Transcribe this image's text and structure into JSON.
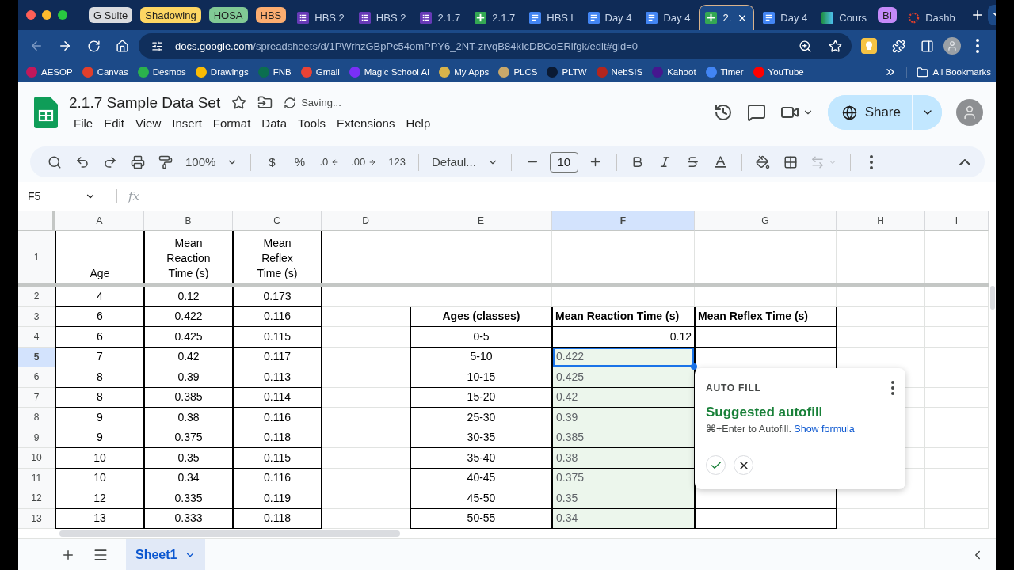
{
  "browser": {
    "tabs": [
      {
        "kind": "group",
        "label": "G Suite",
        "color": "#dadce0",
        "selected": false
      },
      {
        "kind": "group",
        "label": "Shadowing",
        "color": "#fdd663",
        "selected": false
      },
      {
        "kind": "group",
        "label": "HOSA",
        "color": "#81c995",
        "selected": false
      },
      {
        "kind": "group",
        "label": "HBS",
        "color": "#fcad70",
        "selected": false
      },
      {
        "kind": "forms",
        "label": "HBS 2",
        "selected": false
      },
      {
        "kind": "forms",
        "label": "HBS 2",
        "selected": false
      },
      {
        "kind": "forms",
        "label": "2.1.7",
        "selected": false
      },
      {
        "kind": "sheets",
        "label": "2.1.7",
        "selected": false
      },
      {
        "kind": "docs",
        "label": "HBS l",
        "selected": false
      },
      {
        "kind": "docs",
        "label": "Day 4",
        "selected": false
      },
      {
        "kind": "docs",
        "label": "Day 4",
        "selected": false
      },
      {
        "kind": "sheets",
        "label": "2.",
        "selected": true
      },
      {
        "kind": "docs",
        "label": "Day 4",
        "selected": false
      },
      {
        "kind": "classroom",
        "label": "Cours",
        "selected": false
      },
      {
        "kind": "group",
        "label": "BI",
        "color": "#c58af9",
        "selected": false
      },
      {
        "kind": "canvas",
        "label": "Dashb",
        "selected": false
      }
    ],
    "url": {
      "host": "docs.google.com",
      "path": "/spreadsheets/d/1PWrhzGBpPc54omPPY6_2NT-zrvqB84kIcDBCoERifgk/edit#gid=0"
    },
    "bookmarks": [
      {
        "label": "AESOP",
        "color": "#c2185b"
      },
      {
        "label": "Canvas",
        "color": "#e13f2b"
      },
      {
        "label": "Desmos",
        "color": "#2bb24c"
      },
      {
        "label": "Drawings",
        "color": "#fbbc04"
      },
      {
        "label": "FNB",
        "color": "#0b6e4f"
      },
      {
        "label": "Gmail",
        "color": "#ea4335"
      },
      {
        "label": "Magic School AI",
        "color": "#7b2ff7"
      },
      {
        "label": "My Apps",
        "color": "#d9b44a"
      },
      {
        "label": "PLCS",
        "color": "#c9a86a"
      },
      {
        "label": "PLTW",
        "color": "#0a1a33"
      },
      {
        "label": "NebSIS",
        "color": "#b3261e"
      },
      {
        "label": "Kahoot",
        "color": "#46178f"
      },
      {
        "label": "Timer",
        "color": "#4285f4"
      },
      {
        "label": "YouTube",
        "color": "#ff0000"
      }
    ],
    "all_bookmarks": "All Bookmarks"
  },
  "sheets": {
    "title": "2.1.7 Sample Data Set",
    "status": "Saving...",
    "menus": [
      "File",
      "Edit",
      "View",
      "Insert",
      "Format",
      "Data",
      "Tools",
      "Extensions",
      "Help"
    ],
    "share": "Share",
    "toolbar": {
      "zoom": "100%",
      "currency": "$",
      "percent": "%",
      "decimal_decrease": ".0",
      "decimal_increase": ".00",
      "number_format": "123",
      "font": "Defaul...",
      "font_size": "10"
    },
    "name_box": "F5",
    "formula_label": "fx",
    "grid": {
      "columns": [
        {
          "label": "A",
          "selected": false
        },
        {
          "label": "B",
          "selected": false
        },
        {
          "label": "C",
          "selected": false
        },
        {
          "label": "D",
          "selected": false
        },
        {
          "label": "E",
          "selected": false
        },
        {
          "label": "F",
          "selected": true
        },
        {
          "label": "G",
          "selected": false
        },
        {
          "label": "H",
          "selected": false
        },
        {
          "label": "I",
          "selected": false
        }
      ],
      "rows": [
        {
          "number": "1",
          "selected": false,
          "cells": [
            {
              "kind": "header",
              "text": "Age",
              "boxed": true
            },
            {
              "kind": "header",
              "text": "Mean Reaction Time (s)",
              "boxed": true
            },
            {
              "kind": "header",
              "text": "Mean Reflex Time (s)",
              "boxed": true
            },
            {
              "kind": "empty",
              "boxed": false
            },
            {
              "kind": "empty",
              "boxed": false
            },
            {
              "kind": "empty",
              "boxed": false
            },
            {
              "kind": "empty",
              "boxed": false
            },
            {
              "kind": "empty",
              "boxed": false
            },
            {
              "kind": "empty",
              "boxed": false
            }
          ]
        },
        {
          "number": "2",
          "selected": false,
          "cells": [
            {
              "kind": "text",
              "text": "4",
              "boxed": true
            },
            {
              "kind": "text",
              "text": "0.12",
              "boxed": true
            },
            {
              "kind": "text",
              "text": "0.173",
              "boxed": true
            },
            {
              "kind": "empty",
              "boxed": false
            },
            {
              "kind": "empty",
              "boxed": false
            },
            {
              "kind": "empty",
              "boxed": false
            },
            {
              "kind": "empty",
              "boxed": false
            },
            {
              "kind": "empty",
              "boxed": false
            },
            {
              "kind": "empty",
              "boxed": false
            }
          ]
        },
        {
          "number": "3",
          "selected": false,
          "cells": [
            {
              "kind": "text",
              "text": "6",
              "boxed": true
            },
            {
              "kind": "text",
              "text": "0.422",
              "boxed": true
            },
            {
              "kind": "text",
              "text": "0.116",
              "boxed": true
            },
            {
              "kind": "empty",
              "boxed": false
            },
            {
              "kind": "heading",
              "text": "Ages (classes)",
              "boxed": true
            },
            {
              "kind": "title",
              "text": "Mean Reaction Time (s)",
              "boxed": true
            },
            {
              "kind": "title",
              "text": "Mean Reflex Time (s)",
              "boxed": true
            },
            {
              "kind": "empty",
              "boxed": false
            },
            {
              "kind": "empty",
              "boxed": false
            }
          ]
        },
        {
          "number": "4",
          "selected": false,
          "cells": [
            {
              "kind": "text",
              "text": "6",
              "boxed": true
            },
            {
              "kind": "text",
              "text": "0.425",
              "boxed": true
            },
            {
              "kind": "text",
              "text": "0.115",
              "boxed": true
            },
            {
              "kind": "empty",
              "boxed": false
            },
            {
              "kind": "text",
              "text": "0-5",
              "boxed": true
            },
            {
              "kind": "number",
              "text": "0.12",
              "boxed": true
            },
            {
              "kind": "empty",
              "boxed": true
            },
            {
              "kind": "empty",
              "boxed": false
            },
            {
              "kind": "empty",
              "boxed": false
            }
          ]
        },
        {
          "number": "5",
          "selected": true,
          "cells": [
            {
              "kind": "text",
              "text": "7",
              "boxed": true
            },
            {
              "kind": "text",
              "text": "0.42",
              "boxed": true
            },
            {
              "kind": "text",
              "text": "0.117",
              "boxed": true
            },
            {
              "kind": "empty",
              "boxed": false
            },
            {
              "kind": "text",
              "text": "5-10",
              "boxed": true
            },
            {
              "kind": "suggested",
              "text": "0.422",
              "boxed": true
            },
            {
              "kind": "empty",
              "boxed": true
            },
            {
              "kind": "empty",
              "boxed": false
            },
            {
              "kind": "empty",
              "boxed": false
            }
          ]
        },
        {
          "number": "6",
          "selected": false,
          "cells": [
            {
              "kind": "text",
              "text": "8",
              "boxed": true
            },
            {
              "kind": "text",
              "text": "0.39",
              "boxed": true
            },
            {
              "kind": "text",
              "text": "0.113",
              "boxed": true
            },
            {
              "kind": "empty",
              "boxed": false
            },
            {
              "kind": "text",
              "text": "10-15",
              "boxed": true
            },
            {
              "kind": "suggested",
              "text": "0.425",
              "boxed": true
            },
            {
              "kind": "empty",
              "boxed": true
            },
            {
              "kind": "empty",
              "boxed": false
            },
            {
              "kind": "empty",
              "boxed": false
            }
          ]
        },
        {
          "number": "7",
          "selected": false,
          "cells": [
            {
              "kind": "text",
              "text": "8",
              "boxed": true
            },
            {
              "kind": "text",
              "text": "0.385",
              "boxed": true
            },
            {
              "kind": "text",
              "text": "0.114",
              "boxed": true
            },
            {
              "kind": "empty",
              "boxed": false
            },
            {
              "kind": "text",
              "text": "15-20",
              "boxed": true
            },
            {
              "kind": "suggested",
              "text": "0.42",
              "boxed": true
            },
            {
              "kind": "empty"
            },
            {
              "kind": "empty",
              "boxed": false
            },
            {
              "kind": "empty",
              "boxed": false
            }
          ]
        },
        {
          "number": "8",
          "selected": false,
          "cells": [
            {
              "kind": "text",
              "text": "9",
              "boxed": true
            },
            {
              "kind": "text",
              "text": "0.38",
              "boxed": true
            },
            {
              "kind": "text",
              "text": "0.116",
              "boxed": true
            },
            {
              "kind": "empty",
              "boxed": false
            },
            {
              "kind": "text",
              "text": "25-30",
              "boxed": true
            },
            {
              "kind": "suggested",
              "text": "0.39",
              "boxed": true
            },
            {
              "kind": "empty"
            },
            {
              "kind": "empty",
              "boxed": false
            },
            {
              "kind": "empty",
              "boxed": false
            }
          ]
        },
        {
          "number": "9",
          "selected": false,
          "cells": [
            {
              "kind": "text",
              "text": "9",
              "boxed": true
            },
            {
              "kind": "text",
              "text": "0.375",
              "boxed": true
            },
            {
              "kind": "text",
              "text": "0.118",
              "boxed": true
            },
            {
              "kind": "empty",
              "boxed": false
            },
            {
              "kind": "text",
              "text": "30-35",
              "boxed": true
            },
            {
              "kind": "suggested",
              "text": "0.385",
              "boxed": true
            },
            {
              "kind": "empty"
            },
            {
              "kind": "empty",
              "boxed": false
            },
            {
              "kind": "empty",
              "boxed": false
            }
          ]
        },
        {
          "number": "10",
          "selected": false,
          "cells": [
            {
              "kind": "text",
              "text": "10",
              "boxed": true
            },
            {
              "kind": "text",
              "text": "0.35",
              "boxed": true
            },
            {
              "kind": "text",
              "text": "0.115",
              "boxed": true
            },
            {
              "kind": "empty",
              "boxed": false
            },
            {
              "kind": "text",
              "text": "35-40",
              "boxed": true
            },
            {
              "kind": "suggested",
              "text": "0.38",
              "boxed": true
            },
            {
              "kind": "empty"
            },
            {
              "kind": "empty",
              "boxed": false
            },
            {
              "kind": "empty",
              "boxed": false
            }
          ]
        },
        {
          "number": "11",
          "selected": false,
          "cells": [
            {
              "kind": "text",
              "text": "10",
              "boxed": true
            },
            {
              "kind": "text",
              "text": "0.34",
              "boxed": true
            },
            {
              "kind": "text",
              "text": "0.116",
              "boxed": true
            },
            {
              "kind": "empty",
              "boxed": false
            },
            {
              "kind": "text",
              "text": "40-45",
              "boxed": true
            },
            {
              "kind": "suggested",
              "text": "0.375",
              "boxed": true
            },
            {
              "kind": "empty",
              "boxed": true
            },
            {
              "kind": "empty",
              "boxed": false
            },
            {
              "kind": "empty",
              "boxed": false
            }
          ]
        },
        {
          "number": "12",
          "selected": false,
          "cells": [
            {
              "kind": "text",
              "text": "12",
              "boxed": true
            },
            {
              "kind": "text",
              "text": "0.335",
              "boxed": true
            },
            {
              "kind": "text",
              "text": "0.119",
              "boxed": true
            },
            {
              "kind": "empty",
              "boxed": false
            },
            {
              "kind": "text",
              "text": "45-50",
              "boxed": true
            },
            {
              "kind": "suggested",
              "text": "0.35",
              "boxed": true
            },
            {
              "kind": "empty",
              "boxed": true
            },
            {
              "kind": "empty",
              "boxed": false
            },
            {
              "kind": "empty",
              "boxed": false
            }
          ]
        },
        {
          "number": "13",
          "selected": false,
          "cells": [
            {
              "kind": "text",
              "text": "13",
              "boxed": true
            },
            {
              "kind": "text",
              "text": "0.333",
              "boxed": true
            },
            {
              "kind": "text",
              "text": "0.118",
              "boxed": true
            },
            {
              "kind": "empty",
              "boxed": false
            },
            {
              "kind": "text",
              "text": "50-55",
              "boxed": true
            },
            {
              "kind": "suggested",
              "text": "0.34",
              "boxed": true
            },
            {
              "kind": "empty",
              "boxed": true
            },
            {
              "kind": "empty",
              "boxed": false
            },
            {
              "kind": "empty",
              "boxed": false
            }
          ]
        }
      ]
    },
    "autofill": {
      "label": "AUTO FILL",
      "title": "Suggested autofill",
      "hint": "⌘+Enter to Autofill.",
      "link": "Show formula"
    },
    "sheet_tabs": [
      {
        "label": "Sheet1",
        "selected": true
      }
    ]
  }
}
